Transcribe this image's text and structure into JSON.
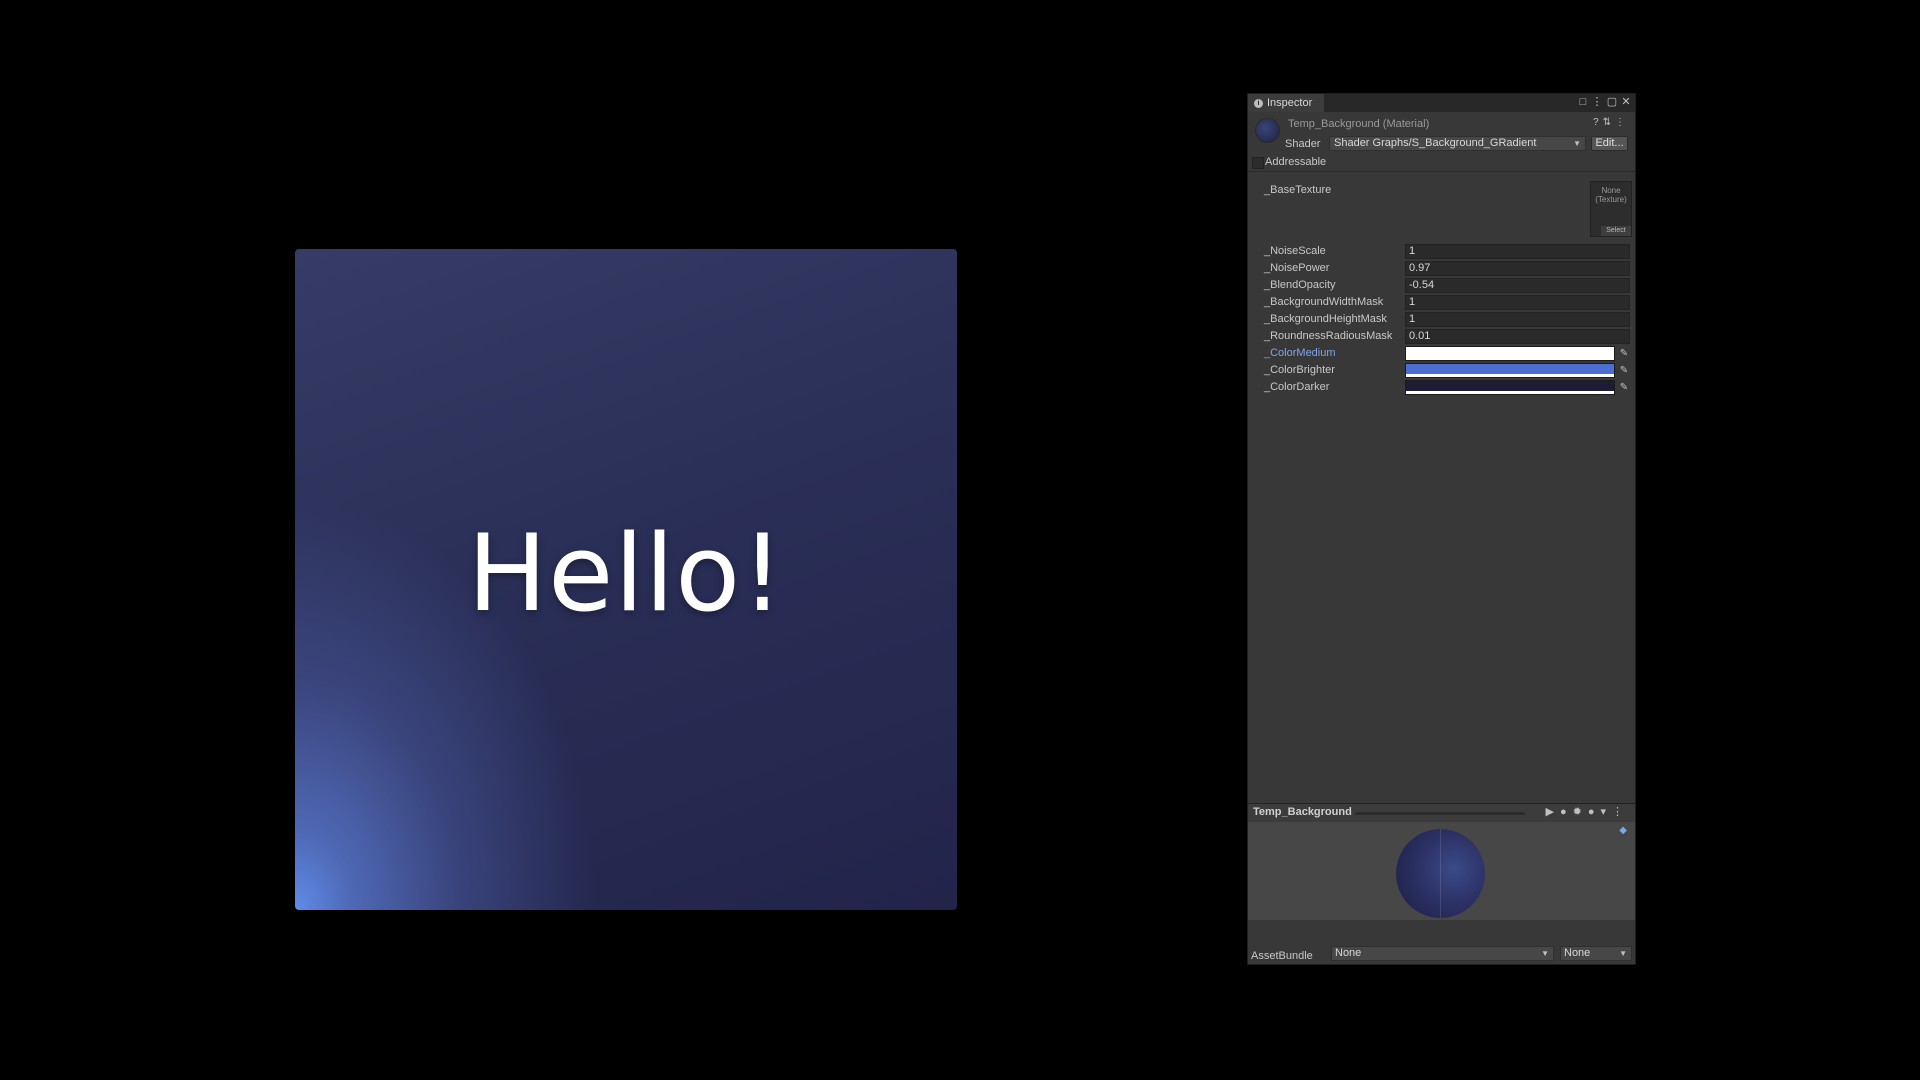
{
  "preview": {
    "text": "Hello!"
  },
  "inspector": {
    "tab_label": "Inspector",
    "material_title": "Temp_Background (Material)",
    "shader_label": "Shader",
    "shader_value": "Shader Graphs/S_Background_GRadient",
    "edit_label": "Edit...",
    "addressable_label": "Addressable",
    "base_texture_label": "_BaseTexture",
    "texture_slot": {
      "line1": "None",
      "line2": "(Texture)",
      "select": "Select"
    },
    "properties": [
      {
        "label": "_NoiseScale",
        "value": "1"
      },
      {
        "label": "_NoisePower",
        "value": "0.97"
      },
      {
        "label": "_BlendOpacity",
        "value": "-0.54"
      },
      {
        "label": "_BackgroundWidthMask",
        "value": "1"
      },
      {
        "label": "_BackgroundHeightMask",
        "value": "1"
      },
      {
        "label": "_RoundnessRadiousMask",
        "value": "0.01"
      }
    ],
    "colors": [
      {
        "label": "_ColorMedium",
        "color": "#ffffff"
      },
      {
        "label": "_ColorBrighter",
        "color": "#4a6fd0"
      },
      {
        "label": "_ColorDarker",
        "color": "#1c1c34"
      }
    ],
    "preview_title": "Temp_Background",
    "assetbundle_label": "AssetBundle",
    "assetbundle_value": "None",
    "assetbundle_variant": "None"
  }
}
